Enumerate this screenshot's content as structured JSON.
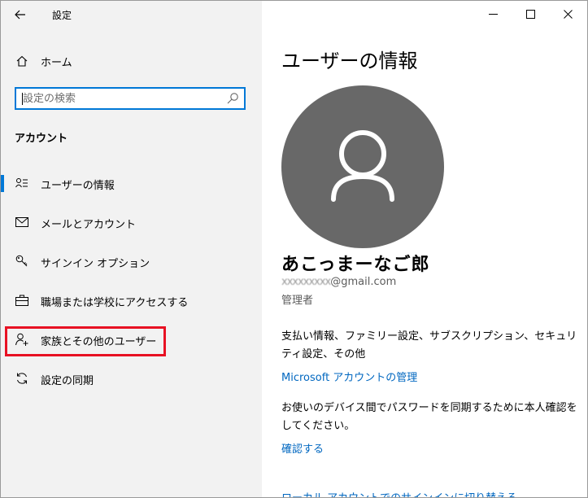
{
  "window": {
    "title": "設定"
  },
  "nav": {
    "home_label": "ホーム",
    "search_placeholder": "設定の検索",
    "section_heading": "アカウント",
    "items": [
      {
        "label": "ユーザーの情報",
        "icon": "user-info-icon",
        "active": true
      },
      {
        "label": "メールとアカウント",
        "icon": "mail-icon",
        "active": false
      },
      {
        "label": "サインイン オプション",
        "icon": "key-icon",
        "active": false
      },
      {
        "label": "職場または学校にアクセスする",
        "icon": "briefcase-icon",
        "active": false
      },
      {
        "label": "家族とその他のユーザー",
        "icon": "add-person-icon",
        "active": false,
        "highlighted": true
      },
      {
        "label": "設定の同期",
        "icon": "sync-icon",
        "active": false
      }
    ]
  },
  "main": {
    "title": "ユーザーの情報",
    "user": {
      "name": "あこっまーなご郎",
      "email_masked": "xxxxxxxxx",
      "email_domain": "@gmail.com",
      "role": "管理者"
    },
    "billing_text": "支払い情報、ファミリー設定、サブスクリプション、セキュリティ設定、その他",
    "manage_link": "Microsoft アカウントの管理",
    "verify_text": "お使いのデバイス間でパスワードを同期するために本人確認をしてください。",
    "verify_link": "確認する",
    "local_link": "ローカル アカウントでのサインインに切り替える"
  },
  "colors": {
    "accent": "#0078d7",
    "link": "#0067c0",
    "highlight": "#e81123",
    "avatar": "#686868",
    "nav_bg": "#f2f2f2"
  }
}
